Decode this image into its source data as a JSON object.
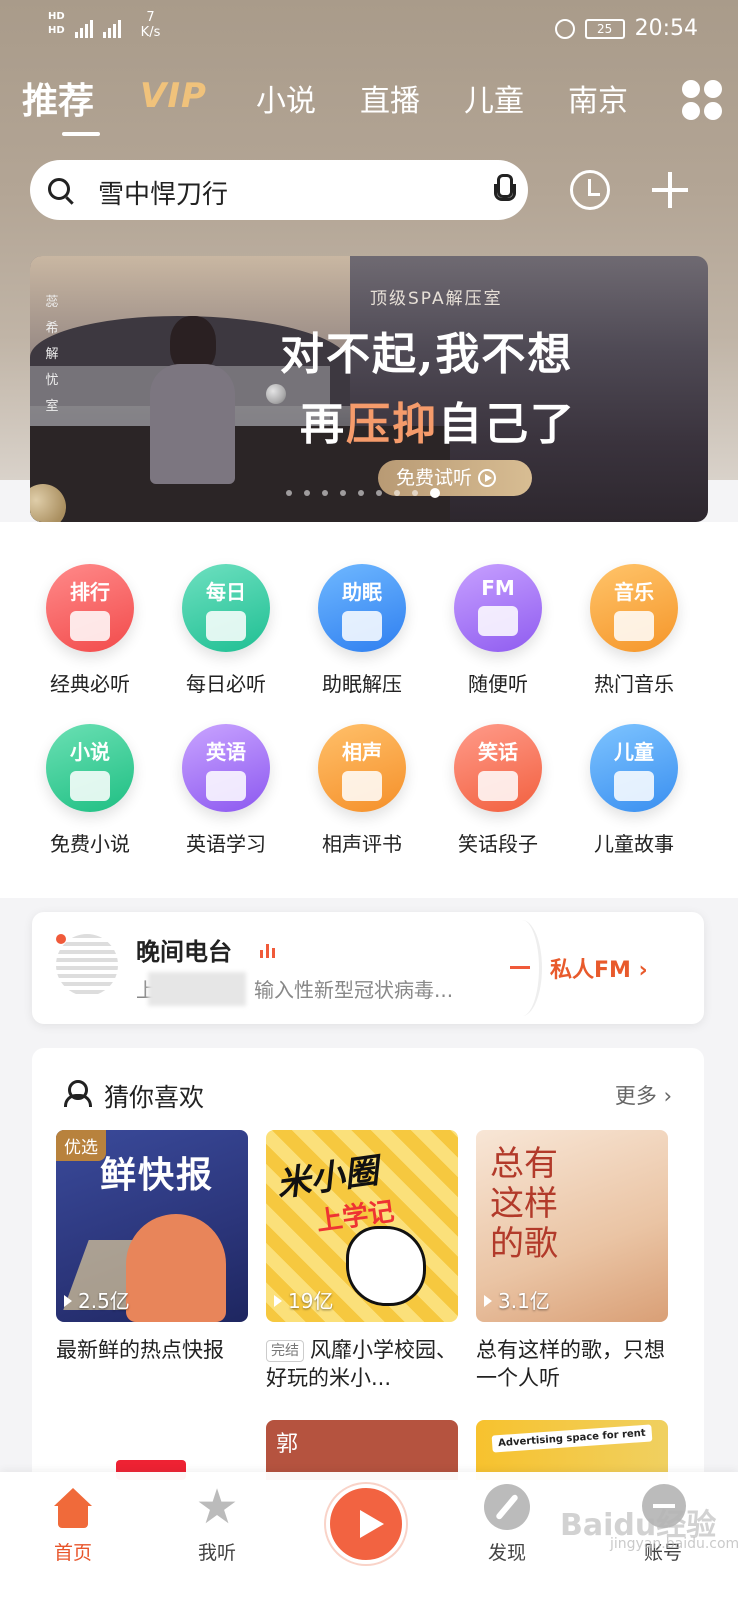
{
  "status_bar": {
    "network_1": "HD",
    "network_2": "HD",
    "sim1": "4G",
    "speed_value": "7",
    "speed_unit": "K/s",
    "battery": "25",
    "time": "20:54"
  },
  "tabs": {
    "recommend": "推荐",
    "vip": "VIP",
    "novel": "小说",
    "live": "直播",
    "kids": "儿童",
    "city": "南京"
  },
  "search": {
    "value": "雪中悍刀行"
  },
  "banner": {
    "side_text": [
      "蕊",
      "希",
      "解",
      "忧",
      "室"
    ],
    "subtitle": "顶级SPA解压室",
    "line1": "对不起,我不想",
    "line2_a": "再",
    "line2_highlight": "压抑",
    "line2_b": "自己了",
    "button": "免费试听",
    "page_count": 9,
    "active_page": 9
  },
  "categories": [
    {
      "badge": "排行",
      "label": "经典必听",
      "color_a": "#ff8a8a",
      "color_b": "#f24b4b"
    },
    {
      "badge": "每日",
      "label": "每日必听",
      "color_a": "#6ee0c0",
      "color_b": "#1fbf93"
    },
    {
      "badge": "助眠",
      "label": "助眠解压",
      "color_a": "#6fb8ff",
      "color_b": "#2f7ff0"
    },
    {
      "badge": "FM",
      "label": "随便听",
      "color_a": "#c7a0ff",
      "color_b": "#8f5cf0"
    },
    {
      "badge": "音乐",
      "label": "热门音乐",
      "color_a": "#ffc46a",
      "color_b": "#f5962a"
    },
    {
      "badge": "小说",
      "label": "免费小说",
      "color_a": "#6be0b4",
      "color_b": "#1fbf83"
    },
    {
      "badge": "英语",
      "label": "英语学习",
      "color_a": "#c9a4ff",
      "color_b": "#8c58f0"
    },
    {
      "badge": "相声",
      "label": "相声评书",
      "color_a": "#ffc06a",
      "color_b": "#f5902a"
    },
    {
      "badge": "笑话",
      "label": "笑话段子",
      "color_a": "#ff9b8a",
      "color_b": "#f2603f"
    },
    {
      "badge": "儿童",
      "label": "儿童故事",
      "color_a": "#7ec4ff",
      "color_b": "#3a8ff0"
    }
  ],
  "radio": {
    "title": "晚间电台",
    "subtitle_start": "上",
    "subtitle_end": "输入性新型冠状病毒...",
    "fm_label": "私人FM ›"
  },
  "guess": {
    "title": "猜你喜欢",
    "more": "更多 ›",
    "items": [
      {
        "cover_badge": "优选",
        "cover_title": "鲜快报",
        "plays": "2.5亿",
        "title": "最新鲜的热点快报",
        "tag": ""
      },
      {
        "cover_title": "米小圈",
        "cover_sub": "上学记",
        "plays": "19亿",
        "title": "风靡小学校园、好玩的米小...",
        "tag": "完结"
      },
      {
        "cover_title": "总有这样的歌",
        "plays": "3.1亿",
        "title": "总有这样的歌，只想一个人听",
        "tag": ""
      }
    ],
    "row2": {
      "b_text": "郭",
      "c_sign": "Advertising space for rent"
    }
  },
  "bottom_nav": {
    "home": "首页",
    "listen": "我听",
    "discover": "发现",
    "account": "账号"
  },
  "watermark": {
    "text": "Baidu经验",
    "sub": "jingyan.baidu.com"
  }
}
